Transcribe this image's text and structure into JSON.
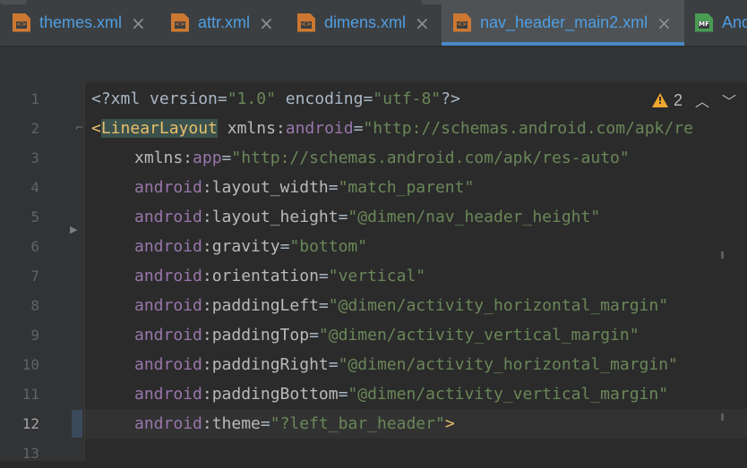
{
  "tabs": [
    {
      "label": "themes.xml",
      "icon": "xml-file-icon",
      "active": false
    },
    {
      "label": "attr.xml",
      "icon": "xml-file-icon",
      "active": false
    },
    {
      "label": "dimens.xml",
      "icon": "xml-file-icon",
      "active": false
    },
    {
      "label": "nav_header_main2.xml",
      "icon": "xml-file-icon",
      "active": true
    },
    {
      "label": "And",
      "icon": "manifest-file-icon",
      "active": false
    }
  ],
  "icons": {
    "close": "×",
    "xml_glyph": "<>",
    "manifest_glyph": "MF"
  },
  "colors": {
    "accent": "#4a88c7",
    "tab_text": "#4f9ee3",
    "warning": "#f0a732",
    "tag": "#e8bf6a",
    "namespace": "#9876aa",
    "string": "#6a8759"
  },
  "inspections": {
    "warning_count": "2",
    "prev_label": "^",
    "next_label": "v",
    "warning_glyph": "!"
  },
  "line_numbers": [
    "1",
    "2",
    "3",
    "4",
    "5",
    "6",
    "7",
    "8",
    "9",
    "10",
    "11",
    "12",
    "13"
  ],
  "code": {
    "l1": {
      "pre": "<?xml version=",
      "v1": "\"1.0\"",
      "mid": " encoding=",
      "v2": "\"utf-8\"",
      "end": "?>"
    },
    "l2": {
      "lt": "<",
      "tag": "LinearLayout",
      "attr": " xmlns:",
      "ns": "android",
      "eq": "=",
      "val": "\"http://schemas.android.com/apk/re"
    },
    "l3": {
      "attr": "xmlns:",
      "ns": "app",
      "eq": "=",
      "val": "\"http://schemas.android.com/apk/res-auto\""
    },
    "l4": {
      "ns": "android",
      "attr": ":layout_width",
      "eq": "=",
      "val": "\"match_parent\""
    },
    "l5": {
      "ns": "android",
      "attr": ":layout_height",
      "eq": "=",
      "val": "\"@dimen/nav_header_height\""
    },
    "l6": {
      "ns": "android",
      "attr": ":gravity",
      "eq": "=",
      "val": "\"bottom\""
    },
    "l7": {
      "ns": "android",
      "attr": ":orientation",
      "eq": "=",
      "val": "\"vertical\""
    },
    "l8": {
      "ns": "android",
      "attr": ":paddingLeft",
      "eq": "=",
      "val": "\"@dimen/activity_horizontal_margin\""
    },
    "l9": {
      "ns": "android",
      "attr": ":paddingTop",
      "eq": "=",
      "val": "\"@dimen/activity_vertical_margin\""
    },
    "l10": {
      "ns": "android",
      "attr": ":paddingRight",
      "eq": "=",
      "val": "\"@dimen/activity_horizontal_margin\""
    },
    "l11": {
      "ns": "android",
      "attr": ":paddingBottom",
      "eq": "=",
      "val": "\"@dimen/activity_vertical_margin\""
    },
    "l12": {
      "ns": "android",
      "attr": ":theme",
      "eq": "=",
      "val": "\"?left_bar_header\"",
      "end": ">"
    }
  }
}
